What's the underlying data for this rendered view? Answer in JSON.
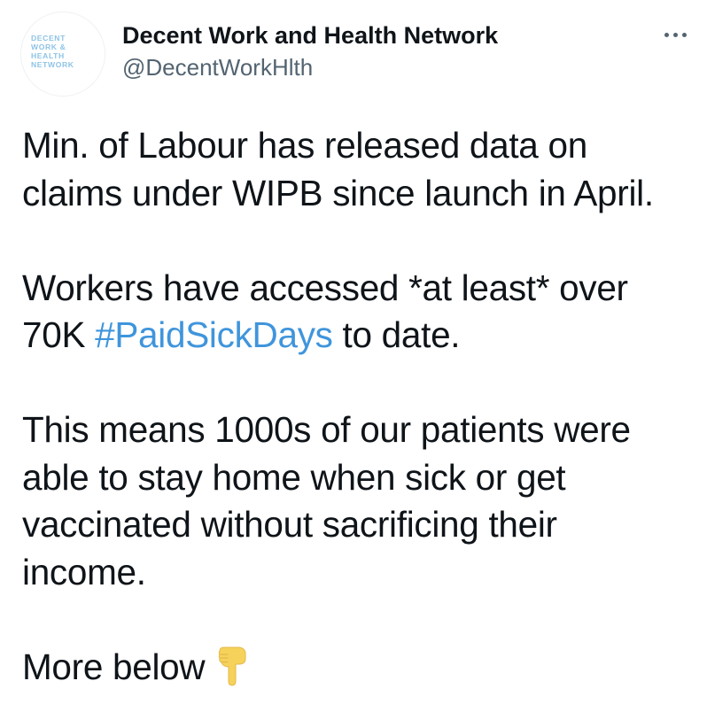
{
  "author": {
    "display_name": "Decent Work and Health Network",
    "handle": "@DecentWorkHlth",
    "avatar_logo_lines": [
      "DECENT",
      "WORK &",
      "HEALTH",
      "NETWORK"
    ]
  },
  "more_icon": "more-horizontal-icon",
  "tweet": {
    "paragraph_1": {
      "line_1": "Min. of Labour has released data on",
      "line_2": "claims under WIPB since launch in April."
    },
    "paragraph_2": {
      "line_1": "Workers have accessed *at least* over",
      "line_2_prefix": "70K ",
      "hashtag": "#PaidSickDays",
      "line_2_suffix": " to date."
    },
    "paragraph_3": {
      "line_1": "This means 1000s of our patients were",
      "line_2": "able to stay home when sick or get",
      "line_3": "vaccinated without sacrificing their",
      "line_4": "income."
    },
    "paragraph_4": {
      "text": "More below",
      "emoji": "backhand-index-pointing-down-icon"
    }
  },
  "colors": {
    "text": "#0f1419",
    "secondary": "#536471",
    "link": "#3f95dc",
    "logo": "#8ec3e6",
    "emoji": "#f7d25a"
  }
}
